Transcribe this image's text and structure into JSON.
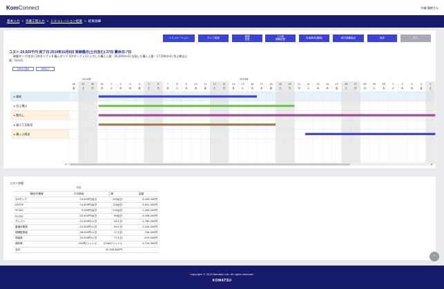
{
  "app": {
    "brand_bold": "Kom",
    "brand_light": "Connect",
    "user": "作業 龍樹さん"
  },
  "breadcrumb": [
    "基本入力",
    "作業工程入力",
    "シミュレーション結果",
    "結果詳細"
  ],
  "toolbar": [
    {
      "label": "シミュレーション",
      "style": "blue"
    },
    {
      "label": "ダンプ変更",
      "style": "blue"
    },
    {
      "label": "機械\n変更",
      "style": "blue"
    },
    {
      "label": "工の初\n期情変更",
      "style": "blue"
    },
    {
      "label": "計画条件(機械)",
      "style": "blue"
    },
    {
      "label": "前行週期結合",
      "style": "blue"
    },
    {
      "label": "保存",
      "style": "blue"
    },
    {
      "label": "終了",
      "style": "gray"
    }
  ],
  "summary": {
    "line1": "コスト:20,929千円 完了日:2019年10月8日 実稼働日(土日含む):37日 費休日:7日",
    "line2": "稼働ダンプ(合計) 10tダンプ x 6 購入ダンプ 10tダンプ x 13 入力した購入土量：20,000(m3) 計画した購入土量：17,500(m3) 残土搬出土",
    "line3": "量：0(m3)"
  },
  "gantt_buttons": [
    "日時表示更新",
    "詳細表示"
  ],
  "gantt": {
    "months": [
      "2019年",
      "2019年"
    ],
    "tasks": [
      {
        "name": "掘削",
        "color": "#e0eefa"
      },
      {
        "name": "切土積込",
        "color": "#ffffff"
      },
      {
        "name": "敷均し",
        "color": "#fdf2e0"
      },
      {
        "name": "盛土工法転送",
        "color": "#ffffff"
      },
      {
        "name": "購入土搬送",
        "color": "#fdf2e0"
      }
    ],
    "days": [
      "28",
      "29",
      "30",
      "31",
      "1",
      "2",
      "3",
      "4",
      "5",
      "6",
      "7",
      "8",
      "9",
      "10",
      "11",
      "12",
      "13",
      "14",
      "15",
      "16",
      "17",
      "18",
      "19",
      "20",
      "21",
      "22",
      "23",
      "24",
      "25",
      "26",
      "27",
      "28",
      "29",
      "30",
      "1",
      "2",
      "3",
      "4",
      "5"
    ],
    "weekdays": [
      "金",
      "土",
      "日",
      "月",
      "火",
      "水",
      "木",
      "金",
      "土",
      "日",
      "月",
      "火",
      "水",
      "木",
      "金",
      "土",
      "日",
      "月",
      "火",
      "水",
      "木",
      "金",
      "土",
      "日",
      "月",
      "火",
      "水",
      "木",
      "金",
      "土",
      "日",
      "月",
      "火",
      "水",
      "火",
      "水",
      "木",
      "金",
      "土"
    ]
  },
  "cost": {
    "title": "コスト詳細",
    "header_top": "今日",
    "headers": [
      "機械/作業種",
      "平均単価",
      "工期",
      "金額"
    ],
    "rows": [
      [
        "10tダンプ",
        "20,000円/台日",
        "200台日",
        "4,000,000円"
      ],
      [
        "D37PX",
        "24,400円/台日",
        "133台日",
        "3,651,400円"
      ],
      [
        "PC200",
        "9,280円/台日",
        "125台日",
        "1,160,000円"
      ],
      [
        "PC200",
        "43,900円/台日",
        "69台日",
        "3,096,000円"
      ],
      [
        "ダンパー",
        "22,000円/人日",
        "80人日",
        "1,760,000円"
      ],
      [
        "重機作業員",
        "15,000円/人日",
        "80人日",
        "1,200,000円"
      ],
      [
        "現場監督者",
        "28,000円/人日",
        "27人日",
        "756,000円"
      ],
      [
        "測量員",
        "25,000円/人日",
        "27人日",
        "675,000円"
      ],
      [
        "燃料費",
        "200円/リットル",
        "23,602リットル",
        "4,720,400円"
      ],
      [
        "合計",
        "",
        "20,928,800円",
        ""
      ]
    ]
  },
  "footer": {
    "copyright": "Copyright © 2015 Komatsu Ltd. All rights reserved.",
    "logo": "KOMATSU"
  },
  "colors": {
    "navy": "#161a6b",
    "accent": "#3a43d6",
    "bar_blue": "#3a43d6",
    "bar_green": "#6cc94f",
    "bar_purple": "#a24a95",
    "bar_brown": "#a37b52"
  }
}
